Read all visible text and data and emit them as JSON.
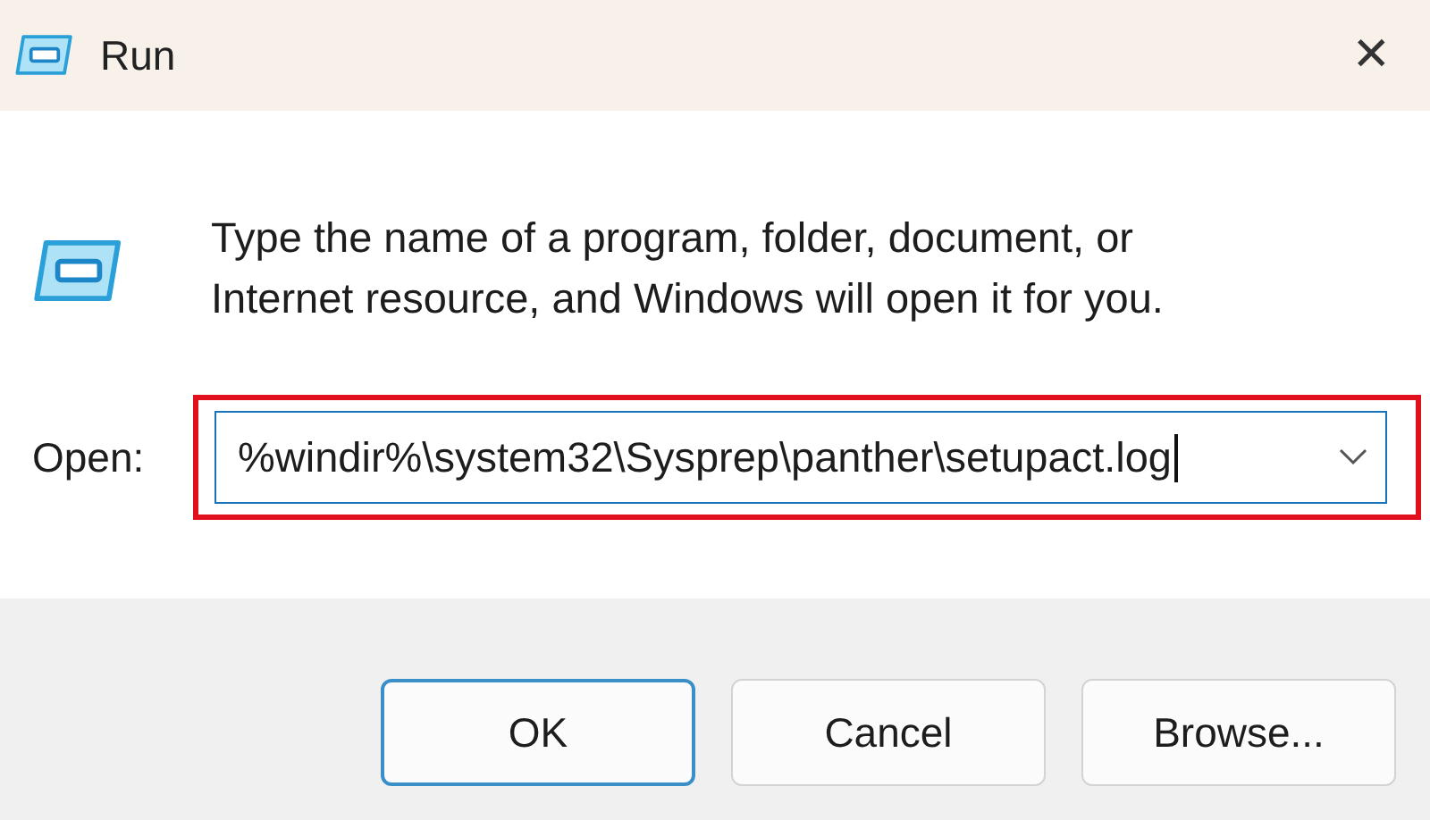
{
  "window": {
    "title": "Run",
    "close": "✕"
  },
  "description": "Type the name of a program, folder, document, or Internet resource, and Windows will open it for you.",
  "open_field": {
    "label": "Open:",
    "value": "%windir%\\system32\\Sysprep\\panther\\setupact.log",
    "highlighted": true
  },
  "buttons": [
    {
      "label": "OK",
      "default": true
    },
    {
      "label": "Cancel",
      "default": false
    },
    {
      "label": "Browse...",
      "default": false
    }
  ]
}
